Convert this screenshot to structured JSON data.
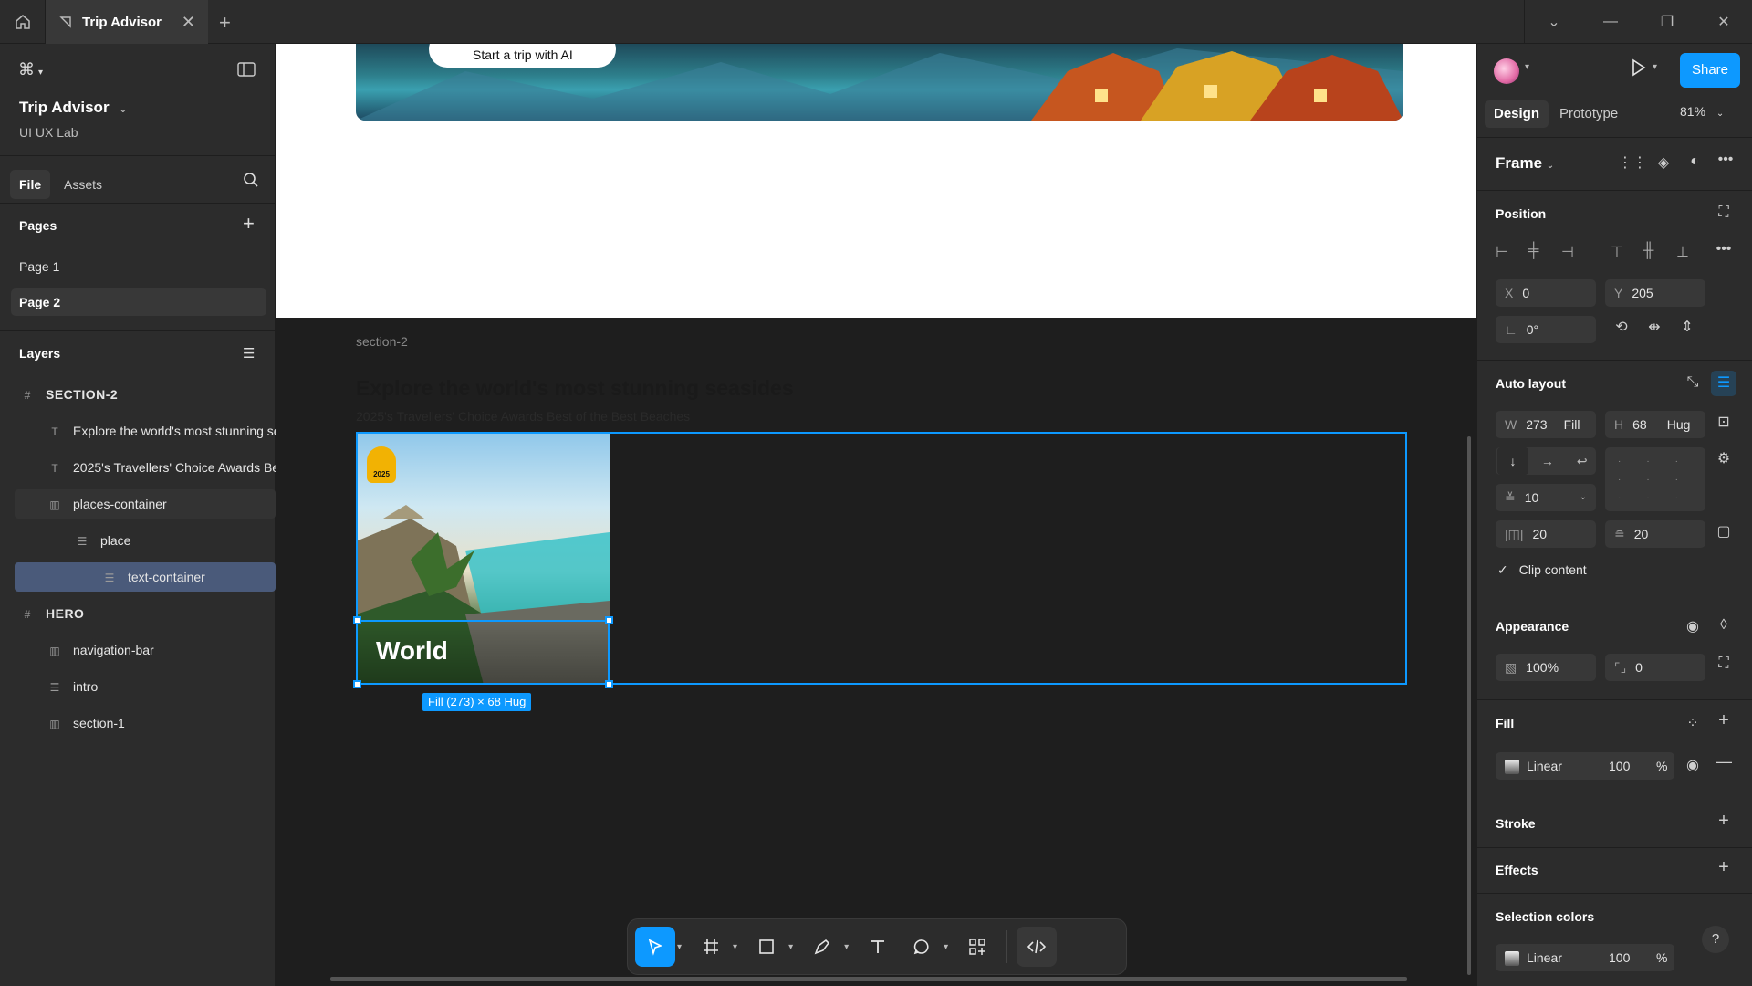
{
  "topbar": {
    "tab_title": "Trip Advisor",
    "window_controls": [
      "chevron-down-icon",
      "minimize-icon",
      "restore-icon",
      "close-icon"
    ]
  },
  "left": {
    "project_title": "Trip Advisor",
    "project_sub": "UI UX Lab",
    "file_tab": "File",
    "assets_tab": "Assets",
    "pages_heading": "Pages",
    "pages": [
      "Page 1",
      "Page 2"
    ],
    "layers_heading": "Layers",
    "layers": [
      {
        "name": "SECTION-2",
        "icon": "frame-icon",
        "indent": 0,
        "bold": true
      },
      {
        "name": "Explore the world's most stunning seasides",
        "icon": "text-icon",
        "indent": 1
      },
      {
        "name": "2025's Travellers' Choice Awards Best of the Best Beaches",
        "icon": "text-icon",
        "indent": 1
      },
      {
        "name": "places-container",
        "icon": "autolayout-h-icon",
        "indent": 1
      },
      {
        "name": "place",
        "icon": "autolayout-v-icon",
        "indent": 2
      },
      {
        "name": "text-container",
        "icon": "autolayout-v-icon",
        "indent": 3,
        "selected": true
      },
      {
        "name": "HERO",
        "icon": "frame-icon",
        "indent": 0,
        "bold": true
      },
      {
        "name": "navigation-bar",
        "icon": "autolayout-h-icon",
        "indent": 1
      },
      {
        "name": "intro",
        "icon": "autolayout-v-icon",
        "indent": 1
      },
      {
        "name": "section-1",
        "icon": "autolayout-h-icon",
        "indent": 1
      }
    ]
  },
  "canvas": {
    "hero_button": "Start a trip with AI",
    "section_label": "section-2",
    "section_title": "Explore the world's most stunning seasides",
    "section_subtitle": "2025's Travellers' Choice Awards Best of the Best Beaches",
    "card_title": "World",
    "badge_year": "2025",
    "size_tag": "Fill (273) × 68 Hug"
  },
  "toolbar": {
    "tools": [
      "move-tool-icon",
      "frame-tool-icon",
      "rectangle-tool-icon",
      "pen-tool-icon",
      "text-tool-icon",
      "comment-tool-icon",
      "components-icon",
      "dev-mode-icon"
    ]
  },
  "right": {
    "share": "Share",
    "design_tab": "Design",
    "prototype_tab": "Prototype",
    "zoom": "81%",
    "frame_label": "Frame",
    "position_heading": "Position",
    "x_label": "X",
    "x_value": "0",
    "y_label": "Y",
    "y_value": "205",
    "rotation": "0°",
    "autolayout_heading": "Auto layout",
    "w_label": "W",
    "w_value": "273",
    "w_mode": "Fill",
    "h_label": "H",
    "h_value": "68",
    "h_mode": "Hug",
    "gap": "10",
    "padding_h": "20",
    "padding_v": "20",
    "clip_content": "Clip content",
    "appearance_heading": "Appearance",
    "opacity": "100%",
    "radius": "0",
    "fill_heading": "Fill",
    "fill_type": "Linear",
    "fill_opacity": "100",
    "fill_pct": "%",
    "stroke_heading": "Stroke",
    "effects_heading": "Effects",
    "selection_colors_heading": "Selection colors",
    "sel_fill_type": "Linear",
    "sel_fill_opacity": "100",
    "sel_fill_pct": "%",
    "help": "?"
  },
  "colors": {
    "accent": "#0d99ff",
    "panel": "#2c2c2c",
    "canvas": "#1e1e1e"
  }
}
